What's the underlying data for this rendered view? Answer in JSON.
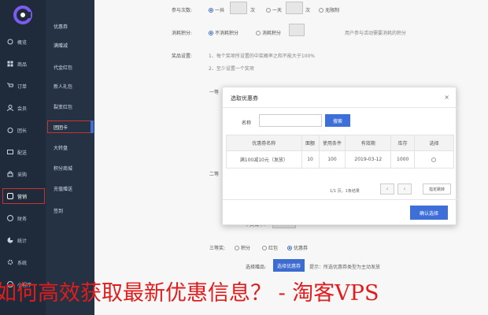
{
  "sidebar": {
    "items": [
      {
        "label": "概览",
        "icon": "home-icon"
      },
      {
        "label": "商品",
        "icon": "grid-icon"
      },
      {
        "label": "订单",
        "icon": "cart-icon"
      },
      {
        "label": "会员",
        "icon": "user-icon"
      },
      {
        "label": "团长",
        "icon": "flag-icon"
      },
      {
        "label": "配送",
        "icon": "truck-icon"
      },
      {
        "label": "采购",
        "icon": "bag-icon"
      },
      {
        "label": "营销",
        "icon": "megaphone-icon"
      },
      {
        "label": "财务",
        "icon": "coin-icon"
      },
      {
        "label": "统计",
        "icon": "chart-icon"
      },
      {
        "label": "系统",
        "icon": "gear-icon"
      },
      {
        "label": "小程序",
        "icon": "miniapp-icon"
      }
    ]
  },
  "submenu": {
    "items": [
      "优惠券",
      "满赠减",
      "代金红包",
      "新人礼包",
      "裂变红包",
      "团团卡",
      "大转盘",
      "积分商城",
      "充值赠送",
      "签到"
    ],
    "active": "团团卡"
  },
  "form": {
    "participation_label": "参与次数:",
    "participation_options": [
      "一共",
      "次",
      "一天",
      "次",
      "无限制"
    ],
    "points_label": "消耗积分:",
    "points_options": [
      "不消耗积分",
      "消耗积分"
    ],
    "points_hint": "用户参与活动需要消耗的积分",
    "prize_label": "奖品设置:",
    "prize_rule_1": "1、每个奖项所设置的中奖概率之和不能大于100%",
    "prize_rule_2": "2、至少设置一个奖项",
    "partial_first": "一等",
    "partial_second": "二等",
    "partial_prob": "中奖概率:",
    "third_label": "三等奖:",
    "third_options": [
      "积分",
      "红包",
      "优惠券"
    ],
    "choose_gift_label": "选择赠品:",
    "choose_coupon_btn": "选择优惠券",
    "choose_hint": "提示：所选优惠券类型为主动发放"
  },
  "modal": {
    "title": "选取优惠券",
    "close": "×",
    "name_label": "名称",
    "search_btn": "搜索",
    "columns": [
      "优惠券名称",
      "面额",
      "使用条件",
      "有效期",
      "库存",
      "选择"
    ],
    "rows": [
      [
        "满100减10元（发放）",
        "10",
        "100",
        "2019-03-12",
        "1000",
        ""
      ]
    ],
    "pager_text": "1/1 页，1条结果",
    "prev": "‹",
    "next": "›",
    "jump": "指定跳转",
    "confirm": "确认选择"
  },
  "watermark": "如何高效获取最新优惠信息？ - 淘客VPS"
}
